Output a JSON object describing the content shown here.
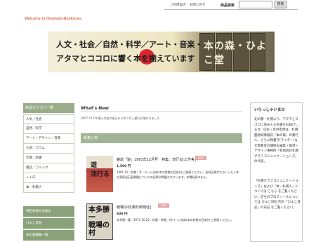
{
  "header": {
    "welcome": "Welcome to Hiyokodo-Bookstore",
    "nav": [
      "ご利用案内",
      "お問い合せ"
    ],
    "search_label": "商品検索",
    "search_placeholder": "",
    "search_button": "検索"
  },
  "banner": {
    "line1": "人文・社会／自然・科学／アート・音楽・・・",
    "line2": "アタマとココロに響く本を揃えています",
    "shop_name": "本の森・ひよこ堂"
  },
  "sidebar": {
    "category_title": "商品カテゴリ一覧",
    "categories": [
      "人文／社会",
      "自然／科学",
      "アート／デザイン／音楽",
      "小説／コラム",
      "文庫／新書",
      "雑誌／コミック",
      "レトロ",
      "本・札幌人"
    ],
    "links": [
      "特定商取引法表示",
      "ひよこ日記",
      "本の森書籍一覧"
    ]
  },
  "main": {
    "whats_new_title": "What's New",
    "whats_new_entry": "2007-11-03  購入代金の振込みにゆうちょ銀行が加わりました",
    "new_arrivals_title": "新着入荷",
    "items": [
      {
        "name": "雑誌「遊」1981年12月号　特集：流行る[工作舎]",
        "badge": "NEW",
        "price": "1,500 円",
        "desc": "1981.12／状態：B／ページ全体(本の状態の目安)をご参照ください。松岡正剛がたちいった八木方東原岩石島景観についての記事が掲載されています。市場発見のまた。"
      },
      {
        "name": "戦場の村[朝日新聞社]",
        "badge": "NEW",
        "price": "600 円",
        "desc": "本多勝一著／1971.10.25／初版／状態：A(ページ全体(本の状態の目安)をご参照ください。"
      }
    ]
  },
  "right": {
    "title": "いらっしゃいませ",
    "text1": "北の都・札幌より、アタマとココロに染み入る古書をお届けします。店主・荒井宏明は、札幌圏地域情報誌『本の森』の発行人、さらに物書き(ライター)＆文章教室の講師＆編集・取材・デザイン事務所「有限会社札幌グラフコミュニケーションズ」の代表。",
    "text2": "「札幌グラフコミュニケーションズ」および『本・札幌人』については こちら をご覧ください。店主のプロフィールについては ひよこ日記 内の『ひよこ日記』の日記 をご覧ください。"
  },
  "colors": {
    "welcome": "#cc3300",
    "sidebar_header": "#99ad8a",
    "side_links": "#8aa27a",
    "section_header": "#a2b495",
    "badge": "#e3a7a7"
  }
}
